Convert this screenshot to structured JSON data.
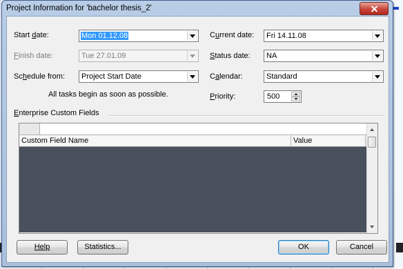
{
  "dialog": {
    "title": "Project Information for 'bachelor thesis_2'"
  },
  "fields": {
    "start_date": {
      "label_pre": "Start ",
      "label_key": "d",
      "label_post": "ate:",
      "value": "Mon 01.12.08"
    },
    "finish_date": {
      "label_pre": "",
      "label_key": "F",
      "label_post": "inish date:",
      "value": "Tue 27.01.09"
    },
    "schedule_from": {
      "label_pre": "Sc",
      "label_key": "h",
      "label_post": "edule from:",
      "value": "Project Start Date"
    },
    "schedule_note": "All tasks begin as soon as possible.",
    "current_date": {
      "label_pre": "C",
      "label_key": "u",
      "label_post": "rrent date:",
      "value": "Fri 14.11.08"
    },
    "status_date": {
      "label_pre": "",
      "label_key": "S",
      "label_post": "tatus date:",
      "value": "NA"
    },
    "calendar": {
      "label_pre": "C",
      "label_key": "a",
      "label_post": "lendar:",
      "value": "Standard"
    },
    "priority": {
      "label_pre": "",
      "label_key": "P",
      "label_post": "riority:",
      "value": "500"
    }
  },
  "enterprise": {
    "label_pre": "",
    "label_key": "E",
    "label_post": "nterprise Custom Fields",
    "columns": [
      "Custom Field Name",
      "Value"
    ]
  },
  "buttons": {
    "help": "Help",
    "statistics": "Statistics...",
    "ok": "OK",
    "cancel": "Cancel"
  },
  "colors": {
    "selection": "#3399ff",
    "dialog_frame": "#a9bfdc",
    "close_button": "#c7453a"
  }
}
